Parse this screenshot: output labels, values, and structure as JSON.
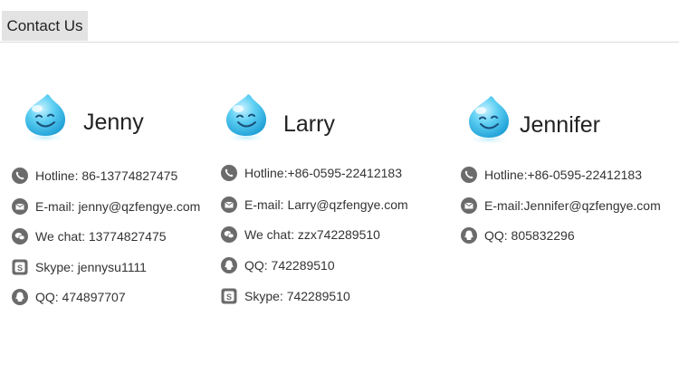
{
  "header": {
    "tab_label": "Contact Us"
  },
  "contacts": [
    {
      "name": "Jenny",
      "rows": [
        {
          "icon": "phone-icon",
          "text": "Hotline: 86-13774827475"
        },
        {
          "icon": "email-icon",
          "text": "E-mail: jenny@qzfengye.com"
        },
        {
          "icon": "wechat-icon",
          "text": "We chat: 13774827475"
        },
        {
          "icon": "skype-icon",
          "text": "Skype: jennysu1111"
        },
        {
          "icon": "qq-icon",
          "text": "QQ: 474897707"
        }
      ]
    },
    {
      "name": "Larry",
      "rows": [
        {
          "icon": "phone-icon",
          "text": "Hotline:+86-0595-22412183"
        },
        {
          "icon": "email-icon",
          "text": "E-mail: Larry@qzfengye.com"
        },
        {
          "icon": "wechat-icon",
          "text": "We chat: zzx742289510"
        },
        {
          "icon": "qq-icon",
          "text": "QQ: 742289510"
        },
        {
          "icon": "skype-icon",
          "text": "Skype: 742289510"
        }
      ]
    },
    {
      "name": "Jennifer",
      "rows": [
        {
          "icon": "phone-icon",
          "text": "Hotline:+86-0595-22412183"
        },
        {
          "icon": "email-icon",
          "text": "E-mail:Jennifer@qzfengye.com"
        },
        {
          "icon": "qq-icon",
          "text": "QQ: 805832296"
        }
      ]
    }
  ],
  "colors": {
    "icon_gray": "#6b6b6b",
    "mascot_blue": "#4cc6ee",
    "tab_bg": "#e3e3e3"
  }
}
